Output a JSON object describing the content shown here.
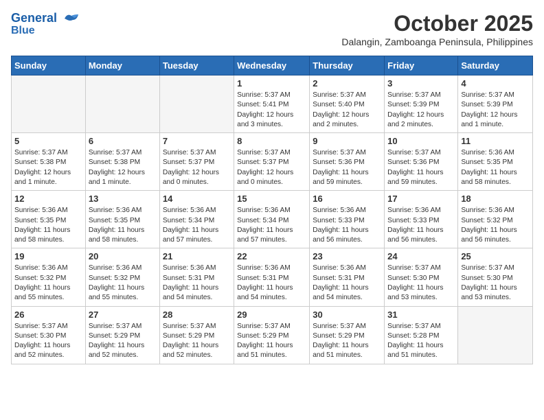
{
  "header": {
    "logo_line1": "General",
    "logo_line2": "Blue",
    "month_year": "October 2025",
    "location": "Dalangin, Zamboanga Peninsula, Philippines"
  },
  "weekdays": [
    "Sunday",
    "Monday",
    "Tuesday",
    "Wednesday",
    "Thursday",
    "Friday",
    "Saturday"
  ],
  "weeks": [
    [
      {
        "day": "",
        "info": ""
      },
      {
        "day": "",
        "info": ""
      },
      {
        "day": "",
        "info": ""
      },
      {
        "day": "1",
        "info": "Sunrise: 5:37 AM\nSunset: 5:41 PM\nDaylight: 12 hours\nand 3 minutes."
      },
      {
        "day": "2",
        "info": "Sunrise: 5:37 AM\nSunset: 5:40 PM\nDaylight: 12 hours\nand 2 minutes."
      },
      {
        "day": "3",
        "info": "Sunrise: 5:37 AM\nSunset: 5:39 PM\nDaylight: 12 hours\nand 2 minutes."
      },
      {
        "day": "4",
        "info": "Sunrise: 5:37 AM\nSunset: 5:39 PM\nDaylight: 12 hours\nand 1 minute."
      }
    ],
    [
      {
        "day": "5",
        "info": "Sunrise: 5:37 AM\nSunset: 5:38 PM\nDaylight: 12 hours\nand 1 minute."
      },
      {
        "day": "6",
        "info": "Sunrise: 5:37 AM\nSunset: 5:38 PM\nDaylight: 12 hours\nand 1 minute."
      },
      {
        "day": "7",
        "info": "Sunrise: 5:37 AM\nSunset: 5:37 PM\nDaylight: 12 hours\nand 0 minutes."
      },
      {
        "day": "8",
        "info": "Sunrise: 5:37 AM\nSunset: 5:37 PM\nDaylight: 12 hours\nand 0 minutes."
      },
      {
        "day": "9",
        "info": "Sunrise: 5:37 AM\nSunset: 5:36 PM\nDaylight: 11 hours\nand 59 minutes."
      },
      {
        "day": "10",
        "info": "Sunrise: 5:37 AM\nSunset: 5:36 PM\nDaylight: 11 hours\nand 59 minutes."
      },
      {
        "day": "11",
        "info": "Sunrise: 5:36 AM\nSunset: 5:35 PM\nDaylight: 11 hours\nand 58 minutes."
      }
    ],
    [
      {
        "day": "12",
        "info": "Sunrise: 5:36 AM\nSunset: 5:35 PM\nDaylight: 11 hours\nand 58 minutes."
      },
      {
        "day": "13",
        "info": "Sunrise: 5:36 AM\nSunset: 5:35 PM\nDaylight: 11 hours\nand 58 minutes."
      },
      {
        "day": "14",
        "info": "Sunrise: 5:36 AM\nSunset: 5:34 PM\nDaylight: 11 hours\nand 57 minutes."
      },
      {
        "day": "15",
        "info": "Sunrise: 5:36 AM\nSunset: 5:34 PM\nDaylight: 11 hours\nand 57 minutes."
      },
      {
        "day": "16",
        "info": "Sunrise: 5:36 AM\nSunset: 5:33 PM\nDaylight: 11 hours\nand 56 minutes."
      },
      {
        "day": "17",
        "info": "Sunrise: 5:36 AM\nSunset: 5:33 PM\nDaylight: 11 hours\nand 56 minutes."
      },
      {
        "day": "18",
        "info": "Sunrise: 5:36 AM\nSunset: 5:32 PM\nDaylight: 11 hours\nand 56 minutes."
      }
    ],
    [
      {
        "day": "19",
        "info": "Sunrise: 5:36 AM\nSunset: 5:32 PM\nDaylight: 11 hours\nand 55 minutes."
      },
      {
        "day": "20",
        "info": "Sunrise: 5:36 AM\nSunset: 5:32 PM\nDaylight: 11 hours\nand 55 minutes."
      },
      {
        "day": "21",
        "info": "Sunrise: 5:36 AM\nSunset: 5:31 PM\nDaylight: 11 hours\nand 54 minutes."
      },
      {
        "day": "22",
        "info": "Sunrise: 5:36 AM\nSunset: 5:31 PM\nDaylight: 11 hours\nand 54 minutes."
      },
      {
        "day": "23",
        "info": "Sunrise: 5:36 AM\nSunset: 5:31 PM\nDaylight: 11 hours\nand 54 minutes."
      },
      {
        "day": "24",
        "info": "Sunrise: 5:37 AM\nSunset: 5:30 PM\nDaylight: 11 hours\nand 53 minutes."
      },
      {
        "day": "25",
        "info": "Sunrise: 5:37 AM\nSunset: 5:30 PM\nDaylight: 11 hours\nand 53 minutes."
      }
    ],
    [
      {
        "day": "26",
        "info": "Sunrise: 5:37 AM\nSunset: 5:30 PM\nDaylight: 11 hours\nand 52 minutes."
      },
      {
        "day": "27",
        "info": "Sunrise: 5:37 AM\nSunset: 5:29 PM\nDaylight: 11 hours\nand 52 minutes."
      },
      {
        "day": "28",
        "info": "Sunrise: 5:37 AM\nSunset: 5:29 PM\nDaylight: 11 hours\nand 52 minutes."
      },
      {
        "day": "29",
        "info": "Sunrise: 5:37 AM\nSunset: 5:29 PM\nDaylight: 11 hours\nand 51 minutes."
      },
      {
        "day": "30",
        "info": "Sunrise: 5:37 AM\nSunset: 5:29 PM\nDaylight: 11 hours\nand 51 minutes."
      },
      {
        "day": "31",
        "info": "Sunrise: 5:37 AM\nSunset: 5:28 PM\nDaylight: 11 hours\nand 51 minutes."
      },
      {
        "day": "",
        "info": ""
      }
    ]
  ]
}
